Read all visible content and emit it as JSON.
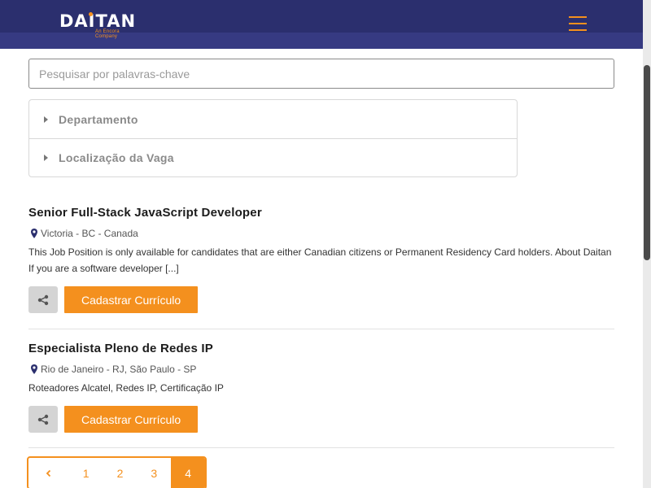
{
  "header": {
    "logo_text": "DAITAN",
    "logo_subtitle": "An Encora Company",
    "menu_icon": "hamburger-menu-icon",
    "accent_color": "#f4901e",
    "brand_color": "#2b2f6e"
  },
  "search": {
    "placeholder": "Pesquisar por palavras-chave",
    "value": ""
  },
  "filters": [
    {
      "label": "Departamento",
      "icon": "caret-right-icon"
    },
    {
      "label": "Localização da Vaga",
      "icon": "caret-right-icon"
    }
  ],
  "jobs": [
    {
      "title": "Senior Full-Stack JavaScript Developer",
      "location": "Victoria - BC - Canada",
      "description": "This Job Position is only available for candidates that are either Canadian citizens or Permanent Residency Card holders. About Daitan If you are a software developer [...]",
      "share_icon": "share-icon",
      "apply_label": "Cadastrar Currículo"
    },
    {
      "title": "Especialista Pleno de Redes IP",
      "location": "Rio de Janeiro - RJ, São Paulo - SP",
      "description": "Roteadores Alcatel, Redes IP, Certificação IP",
      "share_icon": "share-icon",
      "apply_label": "Cadastrar Currículo"
    }
  ],
  "pagination": {
    "prev_icon": "chevron-left-icon",
    "pages": [
      "1",
      "2",
      "3",
      "4"
    ],
    "current": "4"
  }
}
